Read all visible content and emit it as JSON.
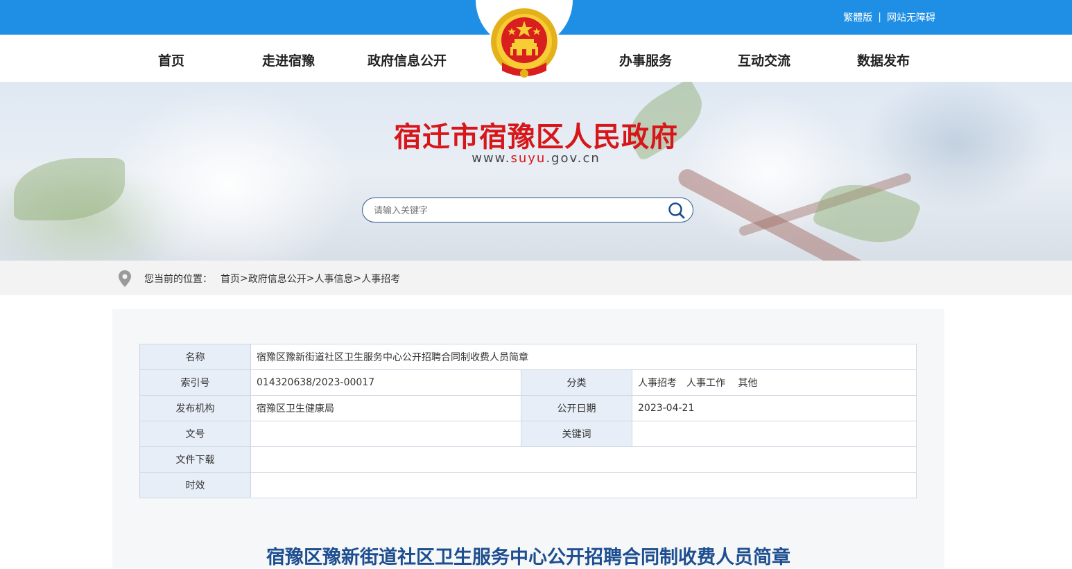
{
  "top_links": {
    "traditional": "繁體版",
    "separator": "|",
    "accessible": "网站无障碍"
  },
  "nav": {
    "home": "首页",
    "about": "走进宿豫",
    "info": "政府信息公开",
    "services": "办事服务",
    "interaction": "互动交流",
    "data": "数据发布"
  },
  "banner": {
    "title": "宿迁市宿豫区人民政府",
    "url_prefix": "www.",
    "url_highlight": "suyu",
    "url_suffix": ".gov.cn"
  },
  "search": {
    "placeholder": "请输入关键字"
  },
  "breadcrumb": {
    "label": "您当前的位置：",
    "items": [
      "首页",
      "政府信息公开",
      "人事信息",
      "人事招考"
    ],
    "separator": ">"
  },
  "meta": {
    "name_label": "名称",
    "name_value": "宿豫区豫新街道社区卫生服务中心公开招聘合同制收费人员简章",
    "index_label": "索引号",
    "index_value": "014320638/2023-00017",
    "category_label": "分类",
    "category_value": "人事招考　人事工作　 其他",
    "publisher_label": "发布机构",
    "publisher_value": "宿豫区卫生健康局",
    "date_label": "公开日期",
    "date_value": "2023-04-21",
    "doc_no_label": "文号",
    "doc_no_value": "",
    "keywords_label": "关键词",
    "keywords_value": "",
    "download_label": "文件下载",
    "download_value": "",
    "validity_label": "时效",
    "validity_value": ""
  },
  "article": {
    "title": "宿豫区豫新街道社区卫生服务中心公开招聘合同制收费人员简章"
  },
  "colors": {
    "topbar": "#1f8fe6",
    "title_red": "#d7161a",
    "heading_blue": "#1d4e8f"
  }
}
